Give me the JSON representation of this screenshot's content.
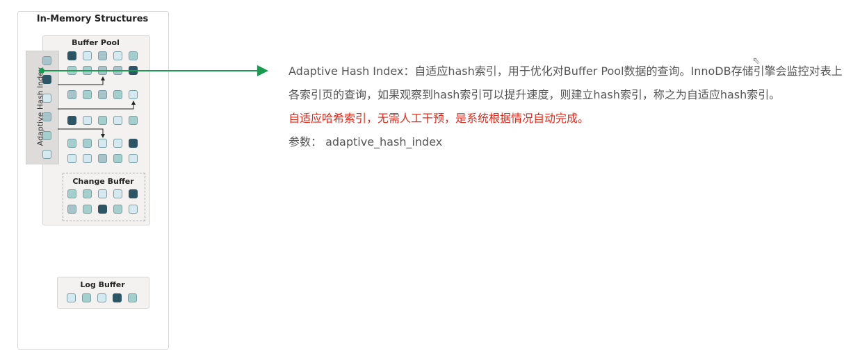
{
  "diagram": {
    "title": "In-Memory Structures",
    "buffer_pool": "Buffer Pool",
    "adaptive_hash_index": "Adaptive Hash Index",
    "change_buffer": "Change Buffer",
    "log_buffer": "Log Buffer",
    "buffer_pool_rows": [
      "dlglt",
      "ttggd",
      "gtgtl",
      "dltlt",
      "ttlld",
      "llgtl"
    ],
    "change_buffer_rows": [
      "ttlld",
      "gtdtl"
    ],
    "ahi_cells": "gdlgtl",
    "log_buffer_cells": "ltldt",
    "colors": {
      "arrow_green": "#1a9a50",
      "dark": "#2c5666",
      "teal": "#a3d0cc",
      "light": "#d5eaf0",
      "grey": "#a7c4cb"
    }
  },
  "description": {
    "line1": "Adaptive Hash Index：自适应hash索引，用于优化对Buffer Pool数据的查询。InnoDB存储引擎会监控对表上各索引页的查询，如果观察到hash索引可以提升速度，则建立hash索引，称之为自适应hash索引。",
    "highlight": "自适应哈希索引，无需人工干预，是系统根据情况自动完成。",
    "param": "参数： adaptive_hash_index"
  }
}
